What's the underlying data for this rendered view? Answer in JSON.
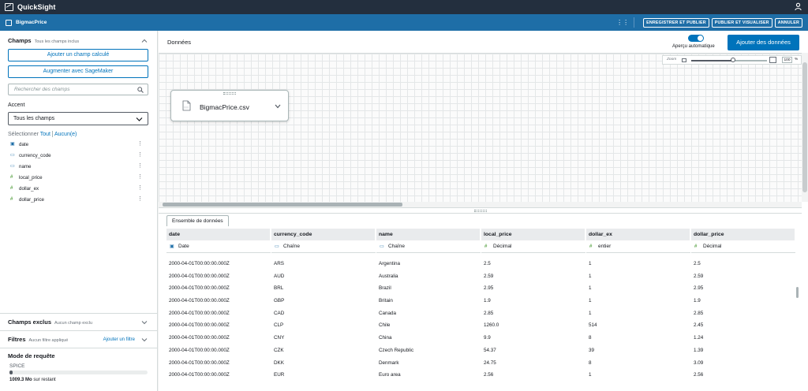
{
  "app": {
    "title": "QuickSight"
  },
  "header": {
    "dataset_name": "BigmacPrice",
    "buttons": [
      "ENREGISTRER ET PUBLIER",
      "PUBLIER ET VISUALISER",
      "ANNULER"
    ]
  },
  "sidebar": {
    "fields_title": "Champs",
    "fields_subtitle": "Tous les champs inclus",
    "add_calc_label": "Ajouter un champ calculé",
    "sagemaker_label": "Augmenter avec SageMaker",
    "search_placeholder": "Rechercher des champs",
    "accent_label": "Accent",
    "accent_value": "Tous les champs",
    "select_label": "Sélectionner",
    "select_all": "Tout",
    "select_none": "Aucun(e)",
    "fields": [
      {
        "name": "date",
        "icon": "calendar-icon"
      },
      {
        "name": "currency_code",
        "icon": "string-icon"
      },
      {
        "name": "name",
        "icon": "string-icon"
      },
      {
        "name": "local_price",
        "icon": "number-icon"
      },
      {
        "name": "dollar_ex",
        "icon": "number-icon"
      },
      {
        "name": "dollar_price",
        "icon": "number-icon"
      }
    ],
    "excluded_title": "Champs exclus",
    "excluded_subtitle": "Aucun champ exclu",
    "filters_title": "Filtres",
    "filters_subtitle": "Aucun filtre appliqué",
    "add_filter_label": "Ajouter un filtre",
    "query_mode_title": "Mode de requête",
    "spice_label": "SPICE",
    "spice_used_fraction": 0.02,
    "remaining_amount": "1009.3 Mo",
    "remaining_suffix": "sur restant"
  },
  "main": {
    "title": "Données",
    "auto_preview_label": "Aperçu automatique",
    "auto_preview_on": true,
    "add_dataset_label": "Ajouter des données",
    "zoom_label": "Zoom",
    "zoom_value": "100",
    "zoom_unit": "%",
    "zoom_fraction": 0.55,
    "node_file": "BigmacPrice.csv",
    "tab_label": "Ensemble de données"
  },
  "table": {
    "columns": [
      {
        "name": "date",
        "type": "Date",
        "type_icon": "calendar-icon"
      },
      {
        "name": "currency_code",
        "type": "Chaîne",
        "type_icon": "string-icon"
      },
      {
        "name": "name",
        "type": "Chaîne",
        "type_icon": "string-icon"
      },
      {
        "name": "local_price",
        "type": "Décimal",
        "type_icon": "number-icon"
      },
      {
        "name": "dollar_ex",
        "type": "entier",
        "type_icon": "number-icon"
      },
      {
        "name": "dollar_price",
        "type": "Décimal",
        "type_icon": "number-icon"
      }
    ],
    "rows": [
      [
        "2000-04-01T00:00:00.000Z",
        "ARS",
        "Argentina",
        "2.5",
        "1",
        "2.5"
      ],
      [
        "2000-04-01T00:00:00.000Z",
        "AUD",
        "Australia",
        "2.59",
        "1",
        "2.59"
      ],
      [
        "2000-04-01T00:00:00.000Z",
        "BRL",
        "Brazil",
        "2.95",
        "1",
        "2.95"
      ],
      [
        "2000-04-01T00:00:00.000Z",
        "GBP",
        "Britain",
        "1.9",
        "1",
        "1.9"
      ],
      [
        "2000-04-01T00:00:00.000Z",
        "CAD",
        "Canada",
        "2.85",
        "1",
        "2.85"
      ],
      [
        "2000-04-01T00:00:00.000Z",
        "CLP",
        "Chile",
        "1260.0",
        "514",
        "2.45"
      ],
      [
        "2000-04-01T00:00:00.000Z",
        "CNY",
        "China",
        "9.9",
        "8",
        "1.24"
      ],
      [
        "2000-04-01T00:00:00.000Z",
        "CZK",
        "Czech Republic",
        "54.37",
        "39",
        "1.39"
      ],
      [
        "2000-04-01T00:00:00.000Z",
        "DKK",
        "Denmark",
        "24.75",
        "8",
        "3.09"
      ],
      [
        "2000-04-01T00:00:00.000Z",
        "EUR",
        "Euro area",
        "2.56",
        "1",
        "2.56"
      ]
    ]
  }
}
